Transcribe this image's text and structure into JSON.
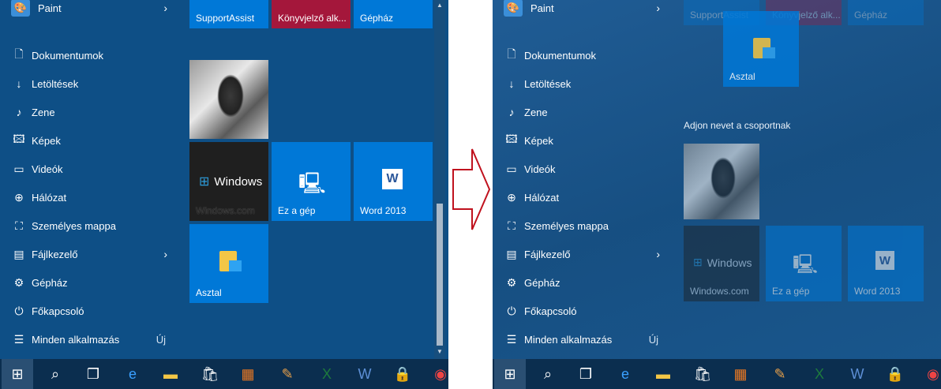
{
  "menu": {
    "paint": "Paint",
    "documents": "Dokumentumok",
    "downloads": "Letöltések",
    "music": "Zene",
    "pictures": "Képek",
    "videos": "Videók",
    "network": "Hálózat",
    "personal_folder": "Személyes mappa",
    "file_explorer": "Fájlkezelő",
    "settings": "Gépház",
    "power": "Főkapcsoló",
    "all_apps": "Minden alkalmazás",
    "new_badge": "Új"
  },
  "tiles": {
    "supportassist": "SupportAssist",
    "ebook": "Könyvjelző alk...",
    "settings": "Gépház",
    "windows_title": "Windows",
    "windows_sub": "Windows.com",
    "this_pc": "Ez a gép",
    "word": "Word 2013",
    "desktop": "Asztal"
  },
  "group_title": "Adjon nevet a csoportnak",
  "icons": {
    "paint": "paint-icon",
    "documents": "document-icon",
    "downloads": "download-icon",
    "music": "music-note-icon",
    "pictures": "picture-icon",
    "videos": "video-icon",
    "network": "globe-icon",
    "personal": "person-folder-icon",
    "explorer": "folder-icon",
    "settings": "gear-icon",
    "power": "power-icon",
    "all_apps": "list-icon"
  },
  "taskbar": [
    "start",
    "search",
    "task-view",
    "edge",
    "explorer",
    "store",
    "office",
    "app",
    "excel",
    "word",
    "keepass",
    "chrome"
  ],
  "colors": {
    "tile_blue": "#0078d7",
    "tile_crimson": "#a4173b",
    "tile_dark": "#1f1f1f",
    "arrow_red": "#c0121e"
  }
}
